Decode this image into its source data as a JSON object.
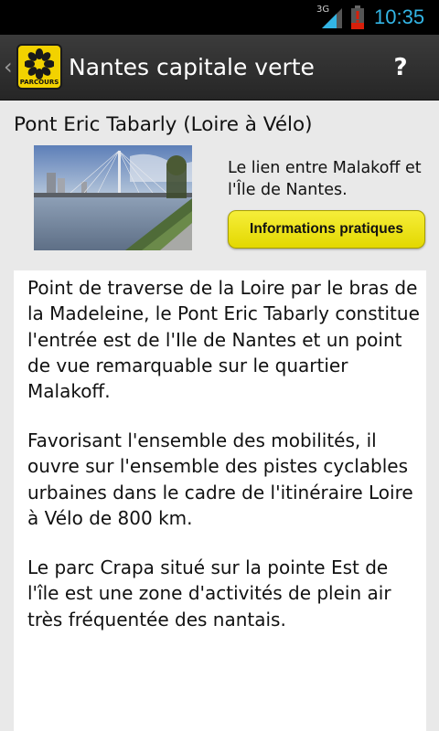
{
  "status_bar": {
    "network": "3G",
    "time": "10:35"
  },
  "action_bar": {
    "logo_text": "PARCOURS",
    "title": "Nantes capitale verte",
    "help_label": "?"
  },
  "place": {
    "title": "Pont Eric Tabarly (Loire à Vélo)",
    "subtitle": "Le lien entre Malakoff et l'Île de Nantes.",
    "info_button": "Informations pratiques"
  },
  "description": {
    "paragraphs": [
      "Point de traverse de la Loire par le bras de la Madeleine, le Pont Eric Tabarly constitue l'entrée est de l'Ile de Nantes et un point de vue remarquable sur le quartier Malakoff.",
      "Favorisant l'ensemble des mobilités, il ouvre sur l'ensemble des pistes cyclables urbaines dans le cadre de l'itinéraire Loire à Vélo de 800 km.",
      "Le parc Crapa situé sur la pointe Est de l'île est une zone d'activités de plein air très fréquentée des nantais."
    ]
  },
  "colors": {
    "clock": "#33b5e5",
    "logo_yellow": "#f2d200",
    "button_yellow": "#eee42a",
    "battery_red": "#d81f0a"
  }
}
